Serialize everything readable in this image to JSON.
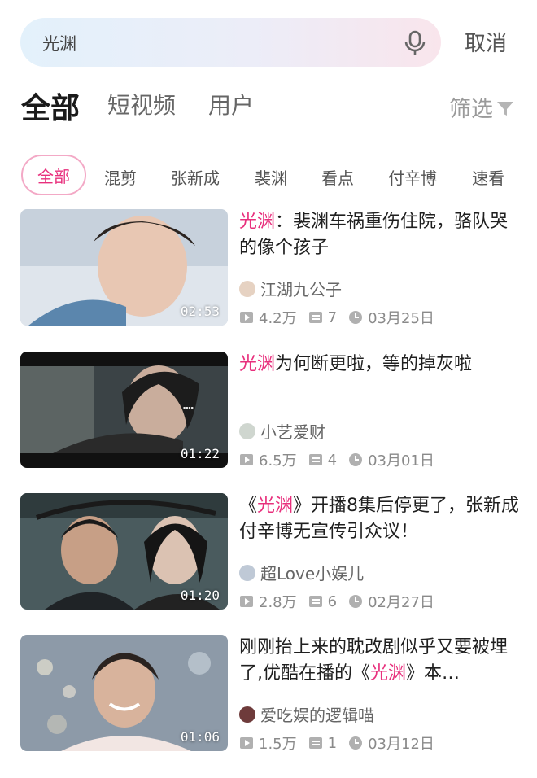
{
  "search": {
    "query": "光渊",
    "cancel_label": "取消"
  },
  "main_tabs": [
    {
      "label": "全部",
      "active": true
    },
    {
      "label": "短视频",
      "active": false
    },
    {
      "label": "用户",
      "active": false
    }
  ],
  "filter": {
    "label": "筛选",
    "icon": "funnel-icon"
  },
  "chips": [
    "全部",
    "混剪",
    "张新成",
    "裴渊",
    "看点",
    "付辛博",
    "速看"
  ],
  "accent_color": "#e8307d",
  "videos": [
    {
      "title_prefix": "",
      "title_highlight": "光渊",
      "title_suffix": "：裴渊车祸重伤住院，骆队哭的像个孩子",
      "duration": "02:53",
      "author": "江湖九公子",
      "plays": "4.2万",
      "episodes": "7",
      "date": "03月25日"
    },
    {
      "title_prefix": "",
      "title_highlight": "光渊",
      "title_suffix": "为何断更啦，等的掉灰啦",
      "duration": "01:22",
      "author": "小艺爱财",
      "plays": "6.5万",
      "episodes": "4",
      "date": "03月01日"
    },
    {
      "title_prefix": "《",
      "title_highlight": "光渊",
      "title_suffix": "》开播8集后停更了，张新成付辛博无宣传引众议！",
      "duration": "01:20",
      "author": "超Love小娱儿",
      "plays": "2.8万",
      "episodes": "6",
      "date": "02月27日"
    },
    {
      "title_prefix": "刚刚抬上来的耽改剧似乎又要被埋了,优酷在播的《",
      "title_highlight": "光渊",
      "title_suffix": "》本…",
      "duration": "01:06",
      "author": "爱吃娱的逻辑喵",
      "plays": "1.5万",
      "episodes": "1",
      "date": "03月12日"
    }
  ]
}
